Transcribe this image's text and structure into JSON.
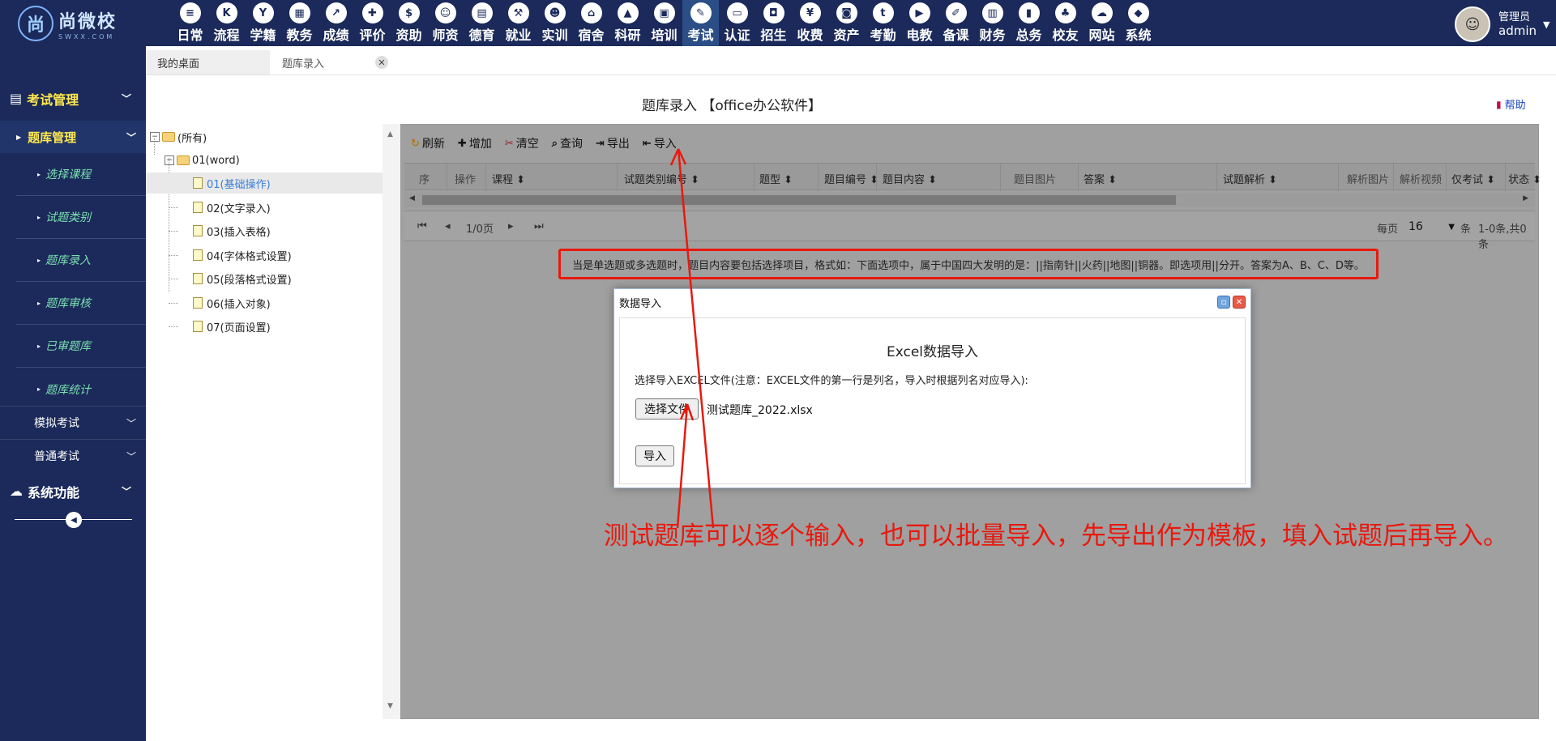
{
  "logo": {
    "mark": "尚",
    "name": "尚微校",
    "domain": "SWXX.COM"
  },
  "modules": [
    {
      "label": "日常",
      "icon": "calendar-icon",
      "glyph": "≡"
    },
    {
      "label": "流程",
      "icon": "flow-icon",
      "glyph": "K"
    },
    {
      "label": "学籍",
      "icon": "student-icon",
      "glyph": "Y"
    },
    {
      "label": "教务",
      "icon": "schedule-icon",
      "glyph": "▦"
    },
    {
      "label": "成绩",
      "icon": "chart-icon",
      "glyph": "↗"
    },
    {
      "label": "评价",
      "icon": "evaluate-icon",
      "glyph": "✚"
    },
    {
      "label": "资助",
      "icon": "aid-icon",
      "glyph": "$"
    },
    {
      "label": "师资",
      "icon": "teacher-icon",
      "glyph": "☺"
    },
    {
      "label": "德育",
      "icon": "book-icon",
      "glyph": "▤"
    },
    {
      "label": "就业",
      "icon": "hammer-icon",
      "glyph": "⚒"
    },
    {
      "label": "实训",
      "icon": "training-icon",
      "glyph": "☻"
    },
    {
      "label": "宿舍",
      "icon": "home-icon",
      "glyph": "⌂"
    },
    {
      "label": "科研",
      "icon": "graduation-icon",
      "glyph": "▲"
    },
    {
      "label": "培训",
      "icon": "image-icon",
      "glyph": "▣"
    },
    {
      "label": "考试",
      "icon": "tools-icon",
      "glyph": "✎"
    },
    {
      "label": "认证",
      "icon": "monitor-icon",
      "glyph": "▭"
    },
    {
      "label": "招生",
      "icon": "bus-icon",
      "glyph": "◘"
    },
    {
      "label": "收费",
      "icon": "yen-icon",
      "glyph": "¥"
    },
    {
      "label": "资产",
      "icon": "train-icon",
      "glyph": "◙"
    },
    {
      "label": "考勤",
      "icon": "tumblr-icon",
      "glyph": "t"
    },
    {
      "label": "电教",
      "icon": "video-icon",
      "glyph": "▶"
    },
    {
      "label": "备课",
      "icon": "edit-icon",
      "glyph": "✐"
    },
    {
      "label": "财务",
      "icon": "newspaper-icon",
      "glyph": "▥"
    },
    {
      "label": "总务",
      "icon": "bar-chart-icon",
      "glyph": "▮"
    },
    {
      "label": "校友",
      "icon": "users-icon",
      "glyph": "♣"
    },
    {
      "label": "网站",
      "icon": "cloud-icon",
      "glyph": "☁"
    },
    {
      "label": "系统",
      "icon": "cube-icon",
      "glyph": "◆"
    }
  ],
  "active_module": "考试",
  "user": {
    "role": "管理员",
    "name": "admin"
  },
  "sidebar": {
    "section": "考试管理",
    "sub": "题库管理",
    "items": [
      "选择课程",
      "试题类别",
      "题库录入",
      "题库审核",
      "已审题库",
      "题库统计"
    ],
    "groups": [
      "模拟考试",
      "普通考试"
    ],
    "system": "系统功能"
  },
  "tabs": [
    {
      "label": "我的桌面"
    },
    {
      "label": "题库录入"
    }
  ],
  "page": {
    "title": "题库录入 【office办公软件】",
    "help": "帮助"
  },
  "tree": {
    "root": "(所有)",
    "folder": "01(word)",
    "nodes": [
      "01(基础操作)",
      "02(文字录入)",
      "03(插入表格)",
      "04(字体格式设置)",
      "05(段落格式设置)",
      "06(插入对象)",
      "07(页面设置)"
    ],
    "selected": "01(基础操作)"
  },
  "toolbar": {
    "refresh": "刷新",
    "add": "增加",
    "clear": "清空",
    "query": "查询",
    "export": "导出",
    "import": "导入"
  },
  "columns": [
    "序",
    "操作",
    "课程",
    "试题类别编号",
    "题型",
    "题目编号",
    "题目内容",
    "题目图片",
    "答案",
    "试题解析",
    "解析图片",
    "解析视频",
    "仅考试",
    "状态"
  ],
  "pager": {
    "pages": "1/0页",
    "per_page_label": "每页",
    "per_page": "16",
    "unit": "条",
    "summary": "1-0条,共0条"
  },
  "hint": "当是单选题或多选题时，题目内容要包括选择项目，格式如：下面选项中，属于中国四大发明的是：||指南针||火药||地图||铜器。即选项用||分开。答案为A、B、C、D等。",
  "modal": {
    "title": "数据导入",
    "heading": "Excel数据导入",
    "note": "选择导入EXCEL文件(注意：EXCEL文件的第一行是列名，导入时根据列名对应导入):",
    "choose_file": "选择文件",
    "file_name": "测试题库_2022.xlsx",
    "import": "导入"
  },
  "annotation": "测试题库可以逐个输入，也可以批量导入，先导出作为模板，填入试题后再导入。",
  "colors": {
    "nav": "#1b2a5a",
    "accent": "#ffe84d",
    "annotation": "#e8190e",
    "menu_link": "#7be0b0"
  }
}
